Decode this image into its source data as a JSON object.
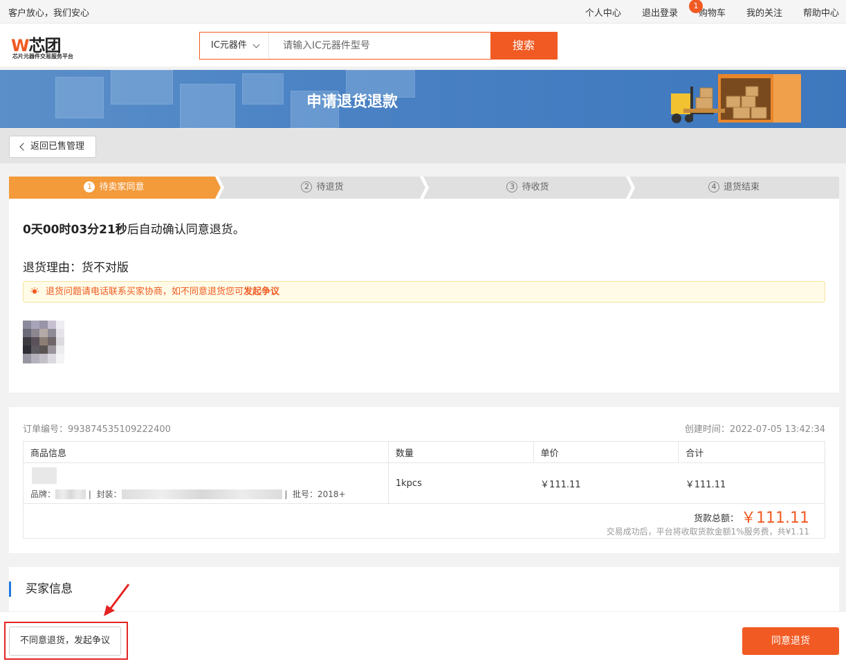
{
  "topbar": {
    "slogan": "客户放心，我们安心",
    "links": [
      "个人中心",
      "退出登录",
      "购物车",
      "我的关注",
      "帮助中心"
    ],
    "cart_count": "1"
  },
  "header": {
    "logo_text_a": "W",
    "logo_text_b": "芯团",
    "logo_sub": "芯片元器件交易服务平台",
    "search_category": "IC元器件",
    "search_placeholder": "请输入IC元器件型号",
    "search_button": "搜索"
  },
  "banner": {
    "title": "申请退货退款"
  },
  "back_button": "返回已售管理",
  "steps": [
    {
      "num": "1",
      "label": "待卖家同意",
      "active": true
    },
    {
      "num": "2",
      "label": "待退货",
      "active": false
    },
    {
      "num": "3",
      "label": "待收货",
      "active": false
    },
    {
      "num": "4",
      "label": "退货结束",
      "active": false
    }
  ],
  "status": {
    "countdown": "0天00时03分21秒",
    "countdown_suffix": "后自动确认同意退货。",
    "reason": "退货理由：货不对版",
    "notice_text": "退货问题请电话联系买家协商，如不同意退货您可",
    "notice_link": "发起争议"
  },
  "order": {
    "order_no": "订单编号：993874535109222400",
    "created": "创建时间：2022-07-05 13:42:34",
    "columns": [
      "商品信息",
      "数量",
      "单价",
      "合计"
    ],
    "brand_label": "品牌：",
    "package_label": "封装：",
    "batch": "批号：2018+",
    "quantity": "1kpcs",
    "unit_price": "￥111.11",
    "subtotal": "￥111.11",
    "total_label": "货款总额：",
    "total": "￥111.11",
    "fee_note": "交易成功后，平台将收取货款金额1%服务费，共¥1.11"
  },
  "buyer": {
    "title": "买家信息"
  },
  "actions": {
    "dispute": "不同意退货，发起争议",
    "agree": "同意退货"
  },
  "colors": {
    "accent": "#f15a22",
    "step_active": "#f39a3b",
    "highlight": "#e52323",
    "section_bar": "#1e7ae0"
  }
}
